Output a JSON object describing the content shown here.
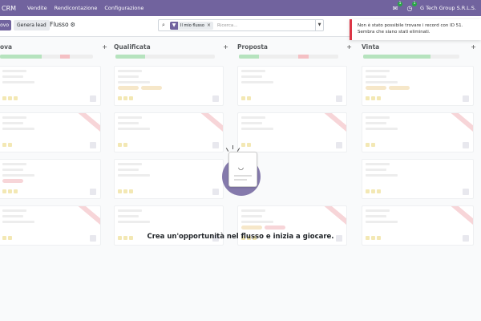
{
  "navbar": {
    "app": "CRM",
    "menu": [
      "Vendite",
      "Rendicontazione",
      "Configurazione"
    ],
    "chat_badge": "1",
    "activity_badge": "1",
    "company": "G Tech Group S.R.L.S."
  },
  "control": {
    "new_label": "ovo",
    "generate_leads_label": "Genera lead",
    "breadcrumb": "Flusso",
    "search": {
      "facet_label": "Il mio flusso",
      "placeholder": "Ricerca..."
    }
  },
  "columns": [
    {
      "title": "ova"
    },
    {
      "title": "Qualificata"
    },
    {
      "title": "Proposta"
    },
    {
      "title": "Vinta"
    }
  ],
  "helper": {
    "text": "Crea un'opportunità nel flusso e inizia a giocare."
  },
  "notification": {
    "message": "Non è stato possibile trovare i record con ID 51. Sembra che siano stati eliminati."
  },
  "colors": {
    "brand": "#71639e",
    "danger": "#dc3545"
  }
}
